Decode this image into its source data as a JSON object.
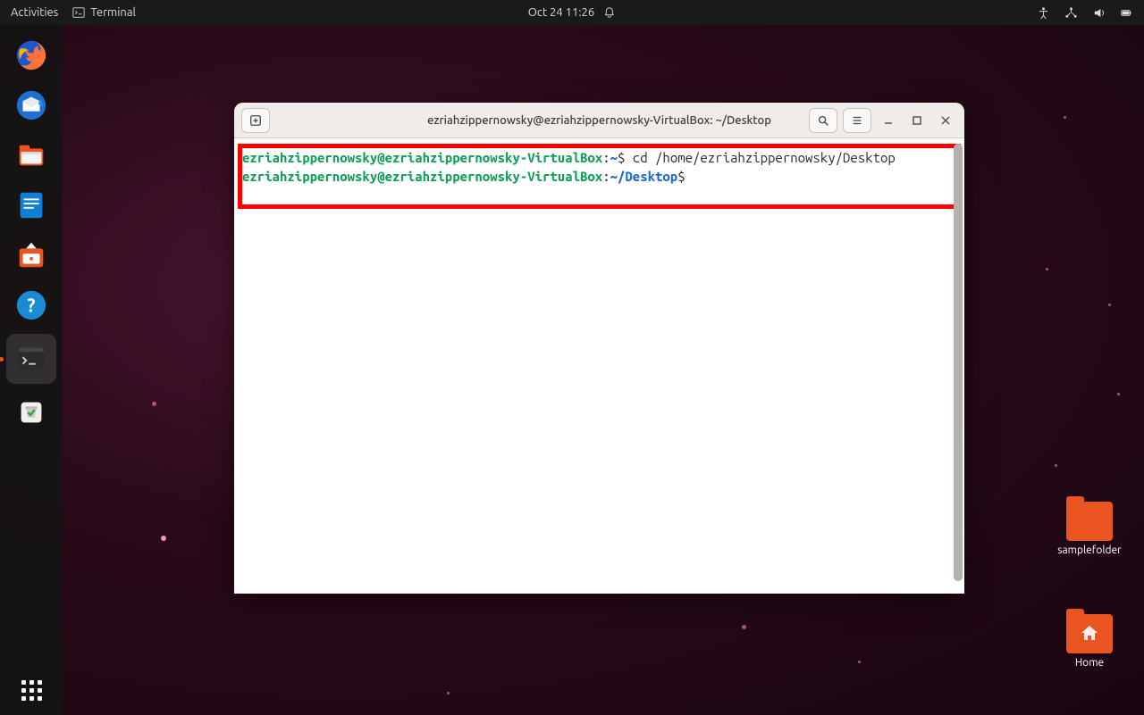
{
  "topbar": {
    "activities": "Activities",
    "app_name": "Terminal",
    "datetime": "Oct 24  11:26"
  },
  "desktop": {
    "folder_label": "samplefolder",
    "home_label": "Home"
  },
  "window": {
    "title": "ezriahzippernowsky@ezriahzippernowsky-VirtualBox: ~/Desktop"
  },
  "terminal": {
    "line1": {
      "userhost": "ezriahzippernowsky@ezriahzippernowsky-VirtualBox",
      "sep": ":",
      "path": "~",
      "prompt": "$",
      "command": " cd /home/ezriahzippernowsky/Desktop"
    },
    "line2": {
      "userhost": "ezriahzippernowsky@ezriahzippernowsky-VirtualBox",
      "sep": ":",
      "path": "~/Desktop",
      "prompt": "$"
    }
  }
}
